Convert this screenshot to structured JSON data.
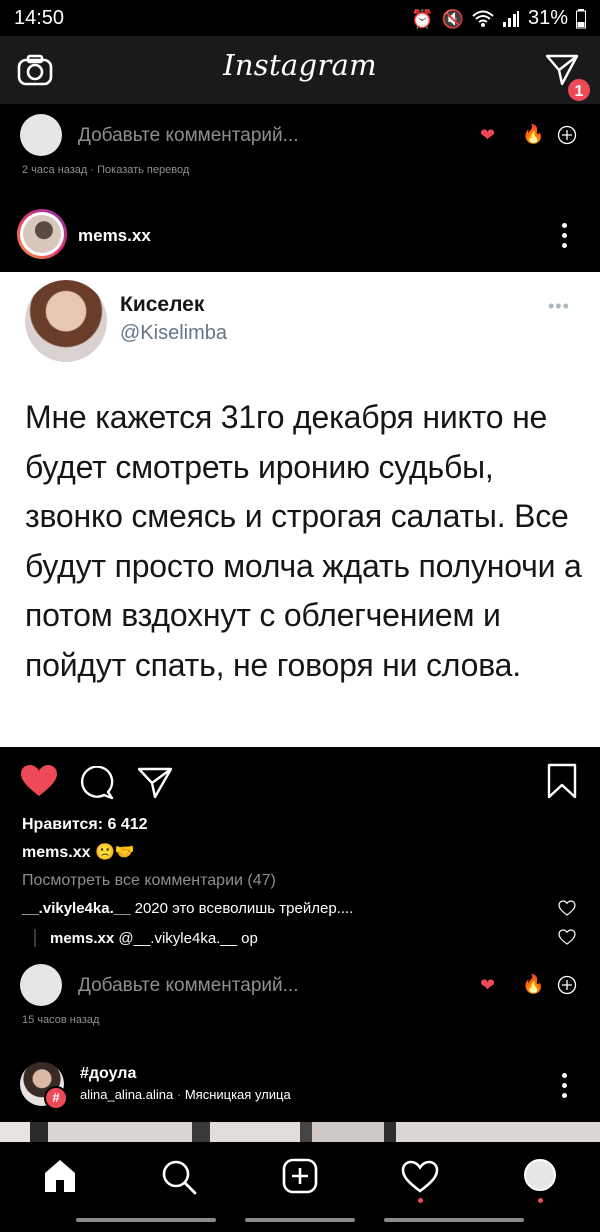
{
  "status_bar": {
    "time": "14:50",
    "battery": "31%"
  },
  "app": {
    "title": "Instagram",
    "dm_badge": "1"
  },
  "top_comment_row": {
    "placeholder": "Добавьте комментарий...",
    "meta": "2 часа назад · Показать перевод"
  },
  "post": {
    "username": "mems.xx",
    "tweet": {
      "name": "Киселек",
      "handle": "@Kiselimba",
      "text": "Мне кажется 31го декабря никто не будет смотреть иронию судьбы, звонко смеясь и строгая салаты. Все будут просто молча ждать полуночи а потом вздохнут с облегчением и пойдут спать, не говоря ни слова."
    },
    "likes": "Нравится: 6 412",
    "caption_user": "mems.xx",
    "caption_emoji": "🙁🤝",
    "view_all": "Посмотреть все комментарии (47)",
    "comments": [
      {
        "user": "__.vikyle4ka.__",
        "text": "2020 это всеволишь трейлер...."
      },
      {
        "user": "mems.xx",
        "text": "@__.vikyle4ka.__ ор"
      }
    ],
    "comment_placeholder": "Добавьте комментарий...",
    "time": "15 часов назад"
  },
  "next_post": {
    "hashtag": "#доула",
    "username": "alina_alina.alina",
    "location": "Мясницкая улица"
  },
  "colors": {
    "accent_red": "#ed4956",
    "background": "#000000",
    "card": "#ffffff"
  }
}
